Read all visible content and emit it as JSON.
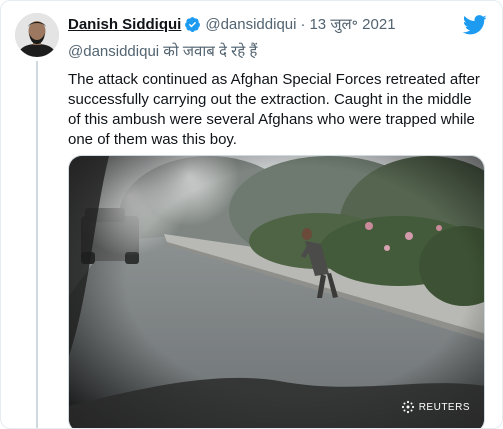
{
  "tweet": {
    "author_name": "Danish Siddiqui",
    "author_handle": "@dansiddiqui",
    "separator": "·",
    "date": "13 जुल॰ 2021",
    "reply_context": "@dansiddiqui को जवाब दे रहे हैं",
    "text": "The attack continued as Afghan Special Forces retreated after successfully carrying out the extraction. Caught in the middle of this ambush were several Afghans who were trapped while one of them was this boy.",
    "media_watermark": "REUTERS"
  },
  "colors": {
    "twitter_blue": "#1d9bf0",
    "primary_text": "#0f1419",
    "secondary_text": "#536471"
  },
  "icons": {
    "verified": "verified-badge-icon",
    "brand": "twitter-bird-icon"
  }
}
